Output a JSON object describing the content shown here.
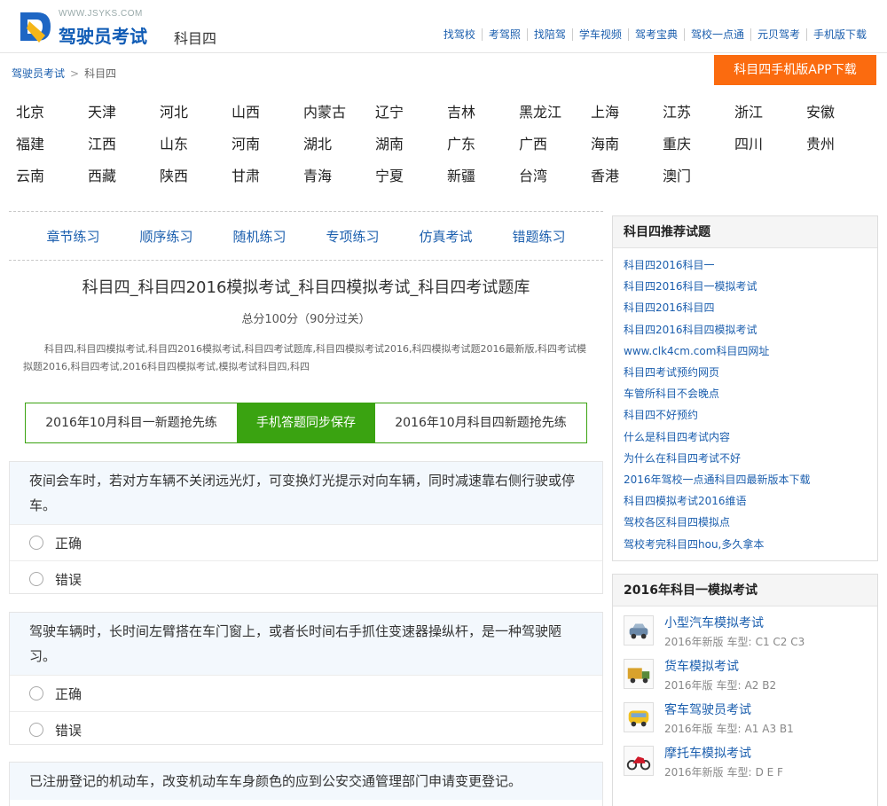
{
  "header": {
    "logo_url_text": "WWW.JSYKS.COM",
    "logo_title": "驾驶员考试",
    "subject": "科目四",
    "brand_color": "#0f5bb5",
    "nav": [
      "找驾校",
      "考驾照",
      "找陪驾",
      "学车视频",
      "驾考宝典",
      "驾校一点通",
      "元贝驾考",
      "手机版下载"
    ]
  },
  "breadcrumb": {
    "home": "驾驶员考试",
    "separator": ">",
    "current": "科目四"
  },
  "app_download": {
    "label": "科目四手机版APP下载",
    "color": "#fb6b0f"
  },
  "regions": [
    [
      "北京",
      "天津",
      "河北",
      "山西",
      "内蒙古",
      "辽宁",
      "吉林",
      "黑龙江",
      "上海",
      "江苏",
      "浙江",
      "安徽"
    ],
    [
      "福建",
      "江西",
      "山东",
      "河南",
      "湖北",
      "湖南",
      "广东",
      "广西",
      "海南",
      "重庆",
      "四川",
      "贵州"
    ],
    [
      "云南",
      "西藏",
      "陕西",
      "甘肃",
      "青海",
      "宁夏",
      "新疆",
      "台湾",
      "香港",
      "澳门"
    ]
  ],
  "practice_tabs": [
    "章节练习",
    "顺序练习",
    "随机练习",
    "专项练习",
    "仿真考试",
    "错题练习"
  ],
  "main": {
    "title": "科目四_科目四2016模拟考试_科目四模拟考试_科目四考试题库",
    "score_line": "总分100分（90分过关）",
    "keywords": "科目四,科目四模拟考试,科目四2016模拟考试,科目四考试题库,科目四模拟考试2016,科四模拟考试题2016最新版,科四考试模拟题2016,科目四考试,2016科目四模拟考试,模拟考试科目四,科四"
  },
  "green_tabs": {
    "tab1": "2016年10月科目一新题抢先练",
    "tab2": "手机答题同步保存",
    "tab3": "2016年10月科目四新题抢先练",
    "color": "#3aa311"
  },
  "questions": [
    {
      "text": "夜间会车时，若对方车辆不关闭远光灯，可变换灯光提示对向车辆，同时减速靠右侧行驶或停车。",
      "options": [
        "正确",
        "错误"
      ]
    },
    {
      "text": "驾驶车辆时，长时间左臂搭在车门窗上，或者长时间右手抓住变速器操纵杆，是一种驾驶陋习。",
      "options": [
        "正确",
        "错误"
      ]
    },
    {
      "text": "已注册登记的机动车，改变机动车车身颜色的应到公安交通管理部门申请变更登记。",
      "options": []
    }
  ],
  "sidebar": {
    "recommended": {
      "title": "科目四推荐试题",
      "links": [
        "科目四2016科目一",
        "科目四2016科目一模拟考试",
        "科目四2016科目四",
        "科目四2016科目四模拟考试",
        "www.clk4cm.com科目四网址",
        "科目四考试预约网页",
        "车管所科目不会晚点",
        "科目四不好预约",
        "什么是科目四考试内容",
        "为什么在科目四考试不好",
        "2016年驾校一点通科目四最新版本下载",
        "科目四模拟考试2016维语",
        "驾校各区科目四模拟点",
        "驾校考完科目四hou,多久拿本"
      ]
    },
    "simulations": {
      "title": "2016年科目一模拟考试",
      "items": [
        {
          "icon": "car-icon",
          "title": "小型汽车模拟考试",
          "edition": "2016年新版",
          "types_label": "车型:",
          "types": "C1 C2 C3"
        },
        {
          "icon": "truck-icon",
          "title": "货车模拟考试",
          "edition": "2016年版",
          "types_label": "车型:",
          "types": "A2 B2"
        },
        {
          "icon": "bus-icon",
          "title": "客车驾驶员考试",
          "edition": "2016年版",
          "types_label": "车型:",
          "types": "A1 A3 B1"
        },
        {
          "icon": "motorcycle-icon",
          "title": "摩托车模拟考试",
          "edition": "2016年新版",
          "types_label": "车型:",
          "types": "D E F"
        }
      ]
    }
  }
}
